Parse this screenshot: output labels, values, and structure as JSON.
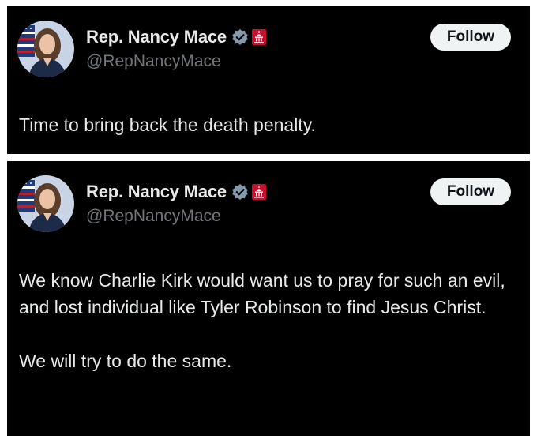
{
  "tweets": [
    {
      "display_name": "Rep. Nancy Mace",
      "handle": "@RepNancyMace",
      "follow_label": "Follow",
      "text_paragraphs": [
        "Time to bring back the death penalty."
      ]
    },
    {
      "display_name": "Rep. Nancy Mace",
      "handle": "@RepNancyMace",
      "follow_label": "Follow",
      "text_paragraphs": [
        "We know Charlie Kirk would want us to pray for such an evil, and lost individual like Tyler Robinson to find Jesus Christ.",
        "We will try to do the same."
      ]
    }
  ],
  "icons": {
    "verified": "verified-badge-icon",
    "government": "capitol-affiliation-icon"
  },
  "colors": {
    "background": "#000000",
    "text": "#e7e9ea",
    "secondary_text": "#71767b",
    "follow_button": "#eff3f4",
    "verified_badge": "#829aab",
    "affiliation_badge": "#c8102e"
  }
}
